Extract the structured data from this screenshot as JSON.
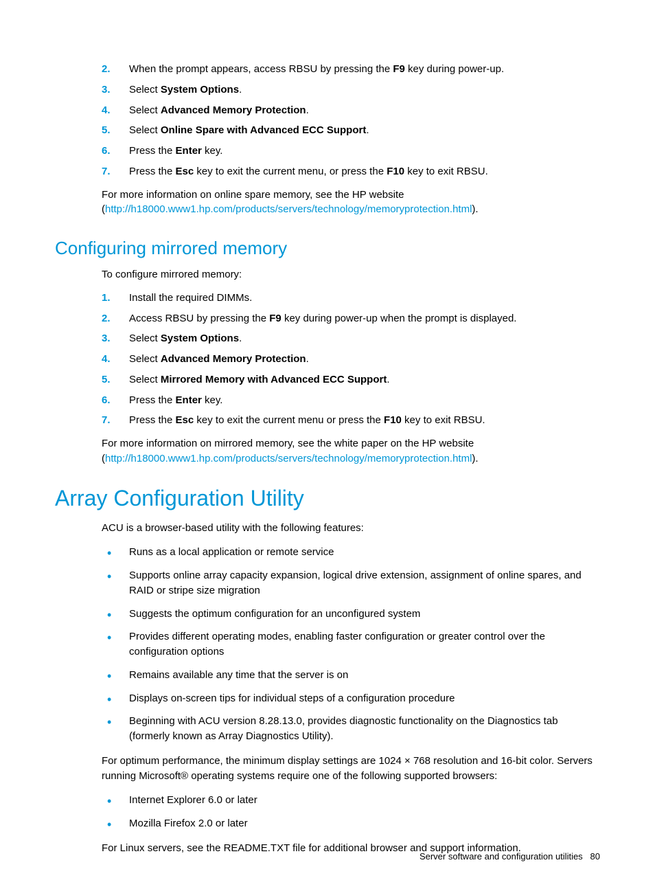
{
  "section1_steps": [
    {
      "num": "2.",
      "pre": "When the prompt appears, access RBSU by pressing the ",
      "bold1": "F9",
      "post1": " key during power-up."
    },
    {
      "num": "3.",
      "pre": "Select ",
      "bold1": "System Options",
      "post1": "."
    },
    {
      "num": "4.",
      "pre": "Select ",
      "bold1": "Advanced Memory Protection",
      "post1": "."
    },
    {
      "num": "5.",
      "pre": "Select ",
      "bold1": "Online Spare with Advanced ECC Support",
      "post1": "."
    },
    {
      "num": "6.",
      "pre": "Press the ",
      "bold1": "Enter",
      "post1": " key."
    },
    {
      "num": "7.",
      "pre": "Press the ",
      "bold1": "Esc",
      "mid": " key to exit the current menu, or press the ",
      "bold2": "F10",
      "post2": " key to exit RBSU."
    }
  ],
  "section1_footer_pre": "For more information on online spare memory, see the HP website (",
  "section1_footer_link": "http://h18000.www1.hp.com/products/servers/technology/memoryprotection.html",
  "section1_footer_post": ").",
  "h2_mirrored": "Configuring mirrored memory",
  "mirrored_intro": "To configure mirrored memory:",
  "mirrored_steps": [
    {
      "num": "1.",
      "pre": "Install the required DIMMs."
    },
    {
      "num": "2.",
      "pre": "Access RBSU by pressing the ",
      "bold1": "F9",
      "post1": " key during power-up when the prompt is displayed."
    },
    {
      "num": "3.",
      "pre": "Select ",
      "bold1": "System Options",
      "post1": "."
    },
    {
      "num": "4.",
      "pre": "Select ",
      "bold1": "Advanced Memory Protection",
      "post1": "."
    },
    {
      "num": "5.",
      "pre": "Select ",
      "bold1": "Mirrored Memory with Advanced ECC Support",
      "post1": "."
    },
    {
      "num": "6.",
      "pre": "Press the ",
      "bold1": "Enter",
      "post1": " key."
    },
    {
      "num": "7.",
      "pre": "Press the ",
      "bold1": "Esc",
      "mid": " key to exit the current menu or press the ",
      "bold2": "F10",
      "post2": " key to exit RBSU."
    }
  ],
  "mirrored_footer_pre": "For more information on mirrored memory, see the white paper on the HP website (",
  "mirrored_footer_link": "http://h18000.www1.hp.com/products/servers/technology/memoryprotection.html",
  "mirrored_footer_post": ").",
  "h1_acu": "Array Configuration Utility",
  "acu_intro": "ACU is a browser-based utility with the following features:",
  "acu_bullets": [
    "Runs as a local application or remote service",
    "Supports online array capacity expansion, logical drive extension, assignment of online spares, and RAID or stripe size migration",
    "Suggests the optimum configuration for an unconfigured system",
    "Provides different operating modes, enabling faster configuration or greater control over the configuration options",
    "Remains available any time that the server is on",
    "Displays on-screen tips for individual steps of a configuration procedure",
    "Beginning with ACU version 8.28.13.0, provides diagnostic functionality on the Diagnostics tab (formerly known as Array Diagnostics Utility)."
  ],
  "acu_perf": "For optimum performance, the minimum display settings are 1024 × 768 resolution and 16-bit color. Servers running Microsoft® operating systems require one of the following supported browsers:",
  "acu_browsers": [
    "Internet Explorer 6.0 or later",
    "Mozilla Firefox 2.0 or later"
  ],
  "acu_linux": "For Linux servers, see the README.TXT file for additional browser and support information.",
  "footer_text": "Server software and configuration utilities",
  "footer_page": "80"
}
